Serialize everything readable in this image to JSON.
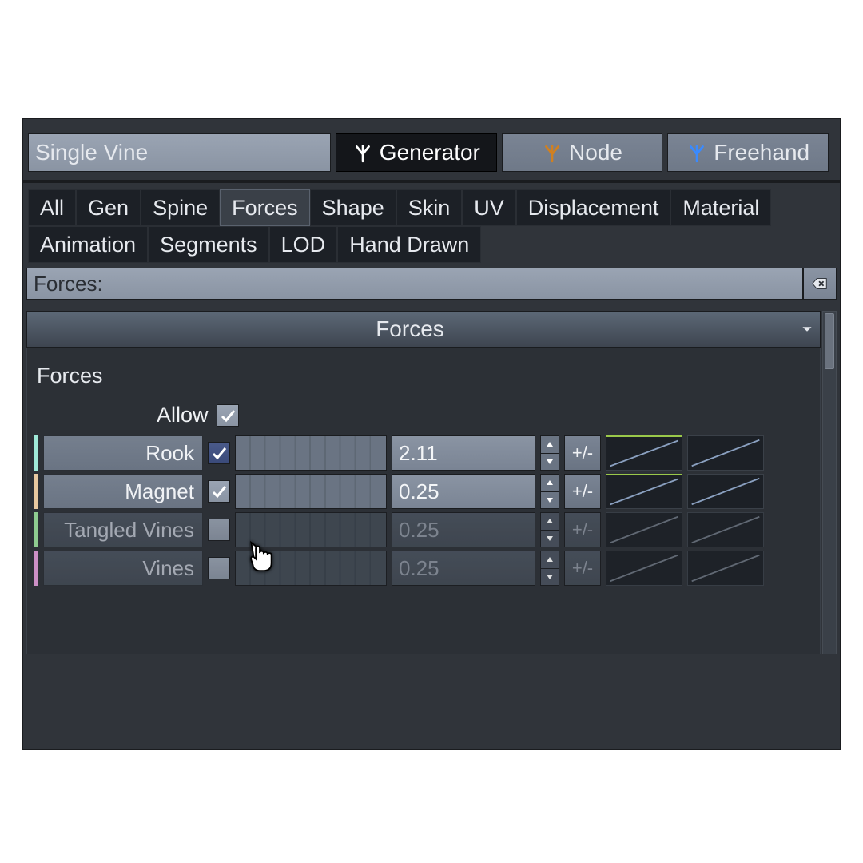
{
  "top": {
    "name_value": "Single Vine",
    "modes": [
      {
        "label": "Generator",
        "icon": "tree-white",
        "active": true
      },
      {
        "label": "Node",
        "icon": "tree-orange",
        "active": false
      },
      {
        "label": "Freehand",
        "icon": "tree-blue",
        "active": false
      }
    ]
  },
  "subtabs": {
    "row1": [
      "All",
      "Gen",
      "Spine",
      "Forces",
      "Shape",
      "Skin",
      "UV",
      "Displacement"
    ],
    "row2": [
      "Material",
      "Animation",
      "Segments",
      "LOD",
      "Hand Drawn"
    ],
    "active": "Forces"
  },
  "search": {
    "label": "Forces:"
  },
  "group": {
    "header": "Forces",
    "subtitle": "Forces",
    "allow": {
      "label": "Allow",
      "checked": true
    },
    "rows": [
      {
        "pip": "#9fe8d8",
        "label": "Rook",
        "checked": true,
        "value": "2.11",
        "enabled": true,
        "pm": "+/-"
      },
      {
        "pip": "#e8c8a0",
        "label": "Magnet",
        "checked": true,
        "value": "0.25",
        "enabled": true,
        "pm": "+/-"
      },
      {
        "pip": "#a0e8a0",
        "label": "Tangled Vines",
        "checked": false,
        "value": "0.25",
        "enabled": false,
        "pm": "+/-"
      },
      {
        "pip": "#e8a0e0",
        "label": "Vines",
        "checked": false,
        "value": "0.25",
        "enabled": false,
        "pm": "+/-"
      }
    ]
  }
}
